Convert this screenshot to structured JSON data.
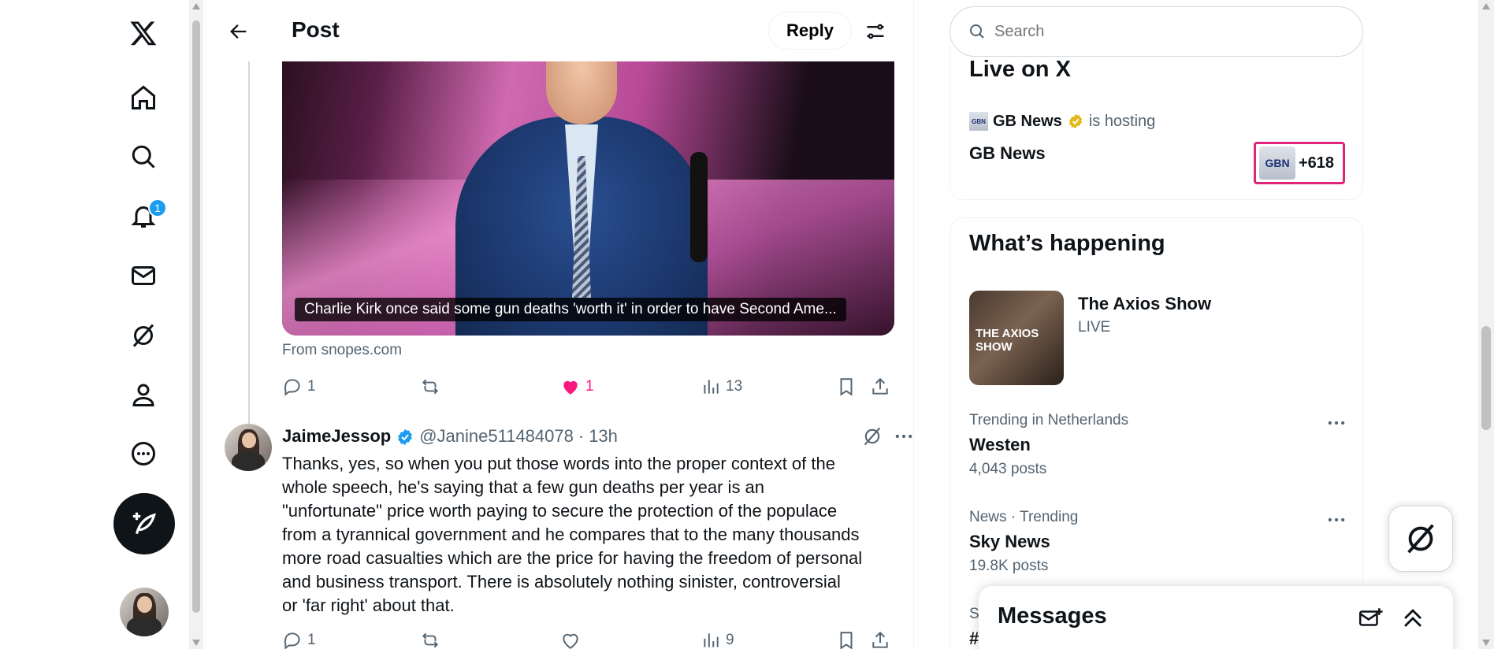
{
  "nav": {
    "items": [
      {
        "name": "x-logo-icon"
      },
      {
        "name": "home-icon"
      },
      {
        "name": "explore-icon"
      },
      {
        "name": "notifications-icon",
        "badge": "1"
      },
      {
        "name": "messages-icon"
      },
      {
        "name": "grok-icon"
      },
      {
        "name": "profile-icon"
      },
      {
        "name": "more-icon"
      }
    ]
  },
  "header": {
    "title": "Post",
    "reply_label": "Reply"
  },
  "post": {
    "media_caption": "Charlie Kirk once said some gun deaths 'worth it' in order to have Second Ame...",
    "source": "From snopes.com",
    "replies": "1",
    "reposts": "",
    "likes": "1",
    "views": "13"
  },
  "reply": {
    "name": "JaimeJessop",
    "handle": "@Janine511484078",
    "dot": "·",
    "time": "13h",
    "text_lines": [
      "Thanks, yes, so when you put those words into the proper context of the",
      "whole speech, he's saying that a few gun deaths per year is an",
      "\"unfortunate\" price worth paying to secure the protection of the populace",
      "from a tyrannical government and he compares that to the many thousands",
      "more road casualties which are the price for having the freedom of personal",
      "and business transport. There is absolutely nothing sinister, controversial",
      "or 'far right' about that."
    ],
    "replies": "1",
    "views": "9"
  },
  "search": {
    "placeholder": "Search"
  },
  "live": {
    "title": "Live on X",
    "host": "GB News",
    "hosting": "is hosting",
    "space_name": "GB News",
    "listener_count": "+618",
    "logo_text": "GBN"
  },
  "happening": {
    "title": "What’s happening",
    "featured": {
      "title": "The Axios Show",
      "status": "LIVE",
      "logo": "THE AXIOS SHOW"
    },
    "trends": [
      {
        "meta": "Trending in Netherlands",
        "name": "Westen",
        "posts": "4,043 posts"
      },
      {
        "meta": "News · Trending",
        "name": "Sky News",
        "posts": "19.8K posts"
      },
      {
        "meta": "S",
        "name": "#",
        "posts": ""
      }
    ]
  },
  "messages": {
    "title": "Messages"
  },
  "colors": {
    "accent": "#1d9bf0",
    "like": "#f91880",
    "highlight": "#e0247a"
  }
}
